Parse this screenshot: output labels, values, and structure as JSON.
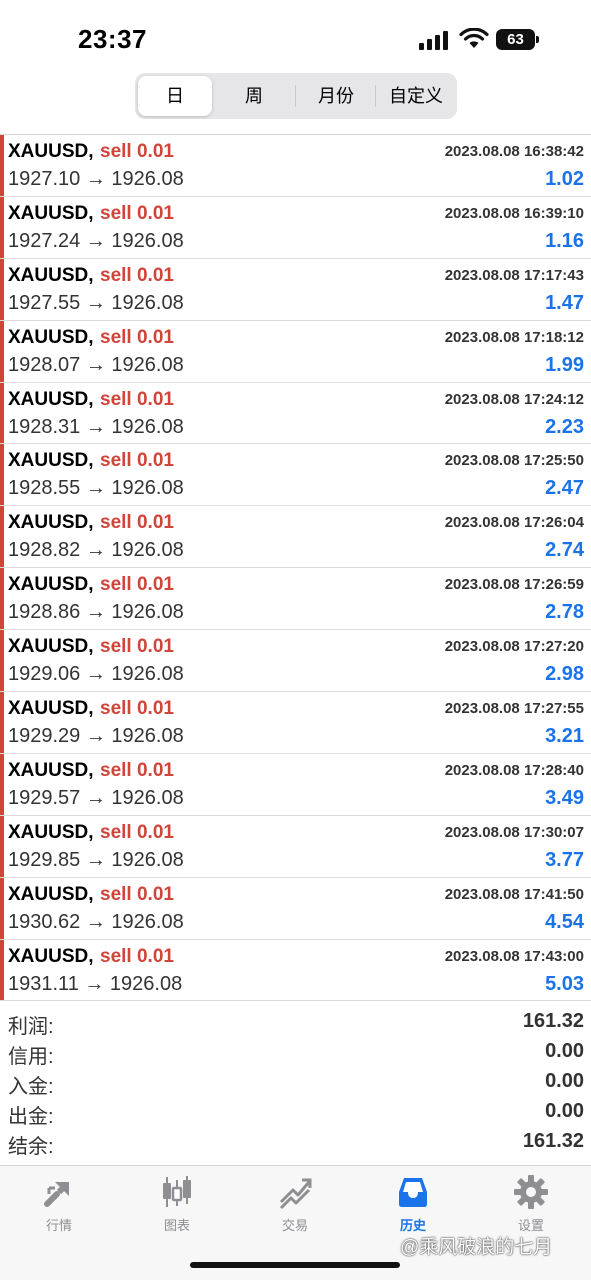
{
  "status": {
    "time": "23:37",
    "battery": "63",
    "icons": [
      "signal-icon",
      "wifi-icon",
      "battery-icon"
    ]
  },
  "tabs_segment": [
    {
      "label": "日",
      "active": true
    },
    {
      "label": "周",
      "active": false
    },
    {
      "label": "月份",
      "active": false
    },
    {
      "label": "自定义",
      "active": false
    }
  ],
  "trades": [
    {
      "symbol": "XAUUSD,",
      "side": "sell 0.01",
      "time": "2023.08.08 16:38:42",
      "prices": "1927.10 → 1926.08",
      "profit": "1.02"
    },
    {
      "symbol": "XAUUSD,",
      "side": "sell 0.01",
      "time": "2023.08.08 16:39:10",
      "prices": "1927.24 → 1926.08",
      "profit": "1.16"
    },
    {
      "symbol": "XAUUSD,",
      "side": "sell 0.01",
      "time": "2023.08.08 17:17:43",
      "prices": "1927.55 → 1926.08",
      "profit": "1.47"
    },
    {
      "symbol": "XAUUSD,",
      "side": "sell 0.01",
      "time": "2023.08.08 17:18:12",
      "prices": "1928.07 → 1926.08",
      "profit": "1.99"
    },
    {
      "symbol": "XAUUSD,",
      "side": "sell 0.01",
      "time": "2023.08.08 17:24:12",
      "prices": "1928.31 → 1926.08",
      "profit": "2.23"
    },
    {
      "symbol": "XAUUSD,",
      "side": "sell 0.01",
      "time": "2023.08.08 17:25:50",
      "prices": "1928.55 → 1926.08",
      "profit": "2.47"
    },
    {
      "symbol": "XAUUSD,",
      "side": "sell 0.01",
      "time": "2023.08.08 17:26:04",
      "prices": "1928.82 → 1926.08",
      "profit": "2.74"
    },
    {
      "symbol": "XAUUSD,",
      "side": "sell 0.01",
      "time": "2023.08.08 17:26:59",
      "prices": "1928.86 → 1926.08",
      "profit": "2.78"
    },
    {
      "symbol": "XAUUSD,",
      "side": "sell 0.01",
      "time": "2023.08.08 17:27:20",
      "prices": "1929.06 → 1926.08",
      "profit": "2.98"
    },
    {
      "symbol": "XAUUSD,",
      "side": "sell 0.01",
      "time": "2023.08.08 17:27:55",
      "prices": "1929.29 → 1926.08",
      "profit": "3.21"
    },
    {
      "symbol": "XAUUSD,",
      "side": "sell 0.01",
      "time": "2023.08.08 17:28:40",
      "prices": "1929.57 → 1926.08",
      "profit": "3.49"
    },
    {
      "symbol": "XAUUSD,",
      "side": "sell 0.01",
      "time": "2023.08.08 17:30:07",
      "prices": "1929.85 → 1926.08",
      "profit": "3.77"
    },
    {
      "symbol": "XAUUSD,",
      "side": "sell 0.01",
      "time": "2023.08.08 17:41:50",
      "prices": "1930.62 → 1926.08",
      "profit": "4.54"
    },
    {
      "symbol": "XAUUSD,",
      "side": "sell 0.01",
      "time": "2023.08.08 17:43:00",
      "prices": "1931.11 → 1926.08",
      "profit": "5.03"
    }
  ],
  "summary": [
    {
      "label": "利润:",
      "value": "161.32"
    },
    {
      "label": "信用:",
      "value": "0.00"
    },
    {
      "label": "入金:",
      "value": "0.00"
    },
    {
      "label": "出金:",
      "value": "0.00"
    },
    {
      "label": "结余:",
      "value": "161.32"
    }
  ],
  "bottom_tabs": [
    {
      "label": "行情",
      "icon": "quotes-icon",
      "active": false
    },
    {
      "label": "图表",
      "icon": "chart-icon",
      "active": false
    },
    {
      "label": "交易",
      "icon": "trade-icon",
      "active": false
    },
    {
      "label": "历史",
      "icon": "history-icon",
      "active": true
    },
    {
      "label": "设置",
      "icon": "settings-icon",
      "active": false
    }
  ],
  "watermark": "@乘风破浪的七月",
  "colors": {
    "sell": "#d0443a",
    "profit": "#1a73e8",
    "active_tab": "#1a73e8",
    "inactive_tab": "#8e8e93"
  }
}
